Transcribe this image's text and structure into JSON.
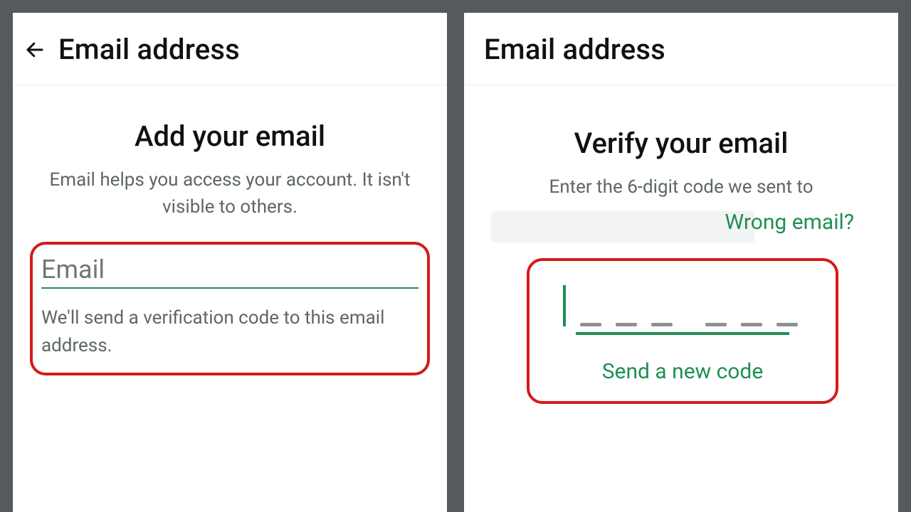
{
  "left": {
    "header_title": "Email address",
    "heading": "Add your email",
    "subtext": "Email helps you access your account. It isn't visible to others.",
    "field_label": "Email",
    "helper": "We'll send a verification code to this email address."
  },
  "right": {
    "header_title": "Email address",
    "heading": "Verify your email",
    "subtext": "Enter the 6-digit code we sent to",
    "wrong_link": "Wrong email?",
    "resend": "Send a new code"
  },
  "colors": {
    "accent": "#1e8f54",
    "highlight": "#d31a1a"
  }
}
